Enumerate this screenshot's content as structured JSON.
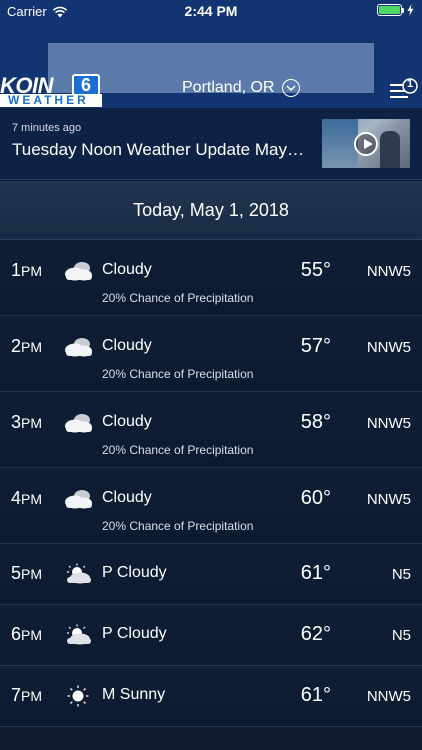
{
  "status_bar": {
    "carrier": "Carrier",
    "time": "2:44 PM",
    "battery_level": 1.0,
    "battery_color": "#4cd964"
  },
  "header": {
    "logo_text": "KOIN",
    "logo_number": "6",
    "logo_subtext": "WEATHER",
    "location": "Portland, OR",
    "menu_badge": "1",
    "background_color": "#123470"
  },
  "video": {
    "time_ago": "7 minutes ago",
    "title": "Tuesday Noon Weather Update May…",
    "thumbnail_icon": "play-icon"
  },
  "date_header": "Today, May 1, 2018",
  "hours": [
    {
      "hour": "1",
      "ampm": "PM",
      "icon": "cloudy-icon",
      "condition": "Cloudy",
      "temp": "55°",
      "wind": "NNW5",
      "precip": "20% Chance of Precipitation"
    },
    {
      "hour": "2",
      "ampm": "PM",
      "icon": "cloudy-icon",
      "condition": "Cloudy",
      "temp": "57°",
      "wind": "NNW5",
      "precip": "20% Chance of Precipitation"
    },
    {
      "hour": "3",
      "ampm": "PM",
      "icon": "cloudy-icon",
      "condition": "Cloudy",
      "temp": "58°",
      "wind": "NNW5",
      "precip": "20% Chance of Precipitation"
    },
    {
      "hour": "4",
      "ampm": "PM",
      "icon": "cloudy-icon",
      "condition": "Cloudy",
      "temp": "60°",
      "wind": "NNW5",
      "precip": "20% Chance of Precipitation"
    },
    {
      "hour": "5",
      "ampm": "PM",
      "icon": "partly-cloudy-icon",
      "condition": "P Cloudy",
      "temp": "61°",
      "wind": "N5"
    },
    {
      "hour": "6",
      "ampm": "PM",
      "icon": "partly-cloudy-icon",
      "condition": "P Cloudy",
      "temp": "62°",
      "wind": "N5"
    },
    {
      "hour": "7",
      "ampm": "PM",
      "icon": "sunny-icon",
      "condition": "M Sunny",
      "temp": "61°",
      "wind": "NNW5"
    }
  ]
}
